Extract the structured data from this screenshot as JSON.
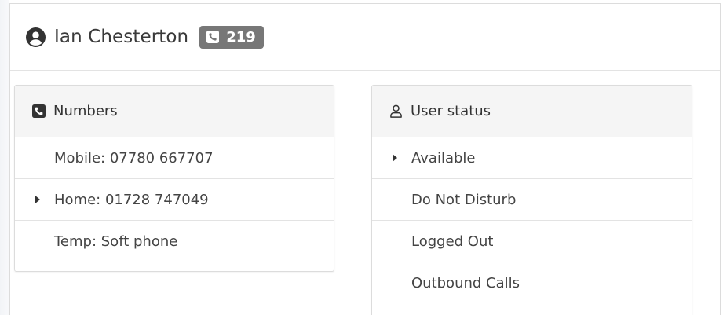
{
  "header": {
    "user_name": "Ian Chesterton",
    "extension": "219"
  },
  "numbers_panel": {
    "title": "Numbers",
    "items": [
      {
        "label": "Mobile: 07780 667707",
        "selected": false
      },
      {
        "label": "Home: 01728 747049",
        "selected": true
      },
      {
        "label": "Temp: Soft phone",
        "selected": false
      }
    ]
  },
  "status_panel": {
    "title": "User status",
    "items": [
      {
        "label": "Available",
        "selected": true
      },
      {
        "label": "Do Not Disturb",
        "selected": false
      },
      {
        "label": "Logged Out",
        "selected": false
      },
      {
        "label": "Outbound Calls",
        "selected": false
      }
    ]
  },
  "colors": {
    "badge_bg": "#777777",
    "panel_heading_bg": "#f5f5f5",
    "border": "#dcdcdc"
  },
  "icons": {
    "user": "user-circle-icon",
    "badge_phone": "phone-square-icon",
    "numbers": "phone-square-icon",
    "status": "user-outline-icon",
    "selection": "caret-right-icon"
  }
}
